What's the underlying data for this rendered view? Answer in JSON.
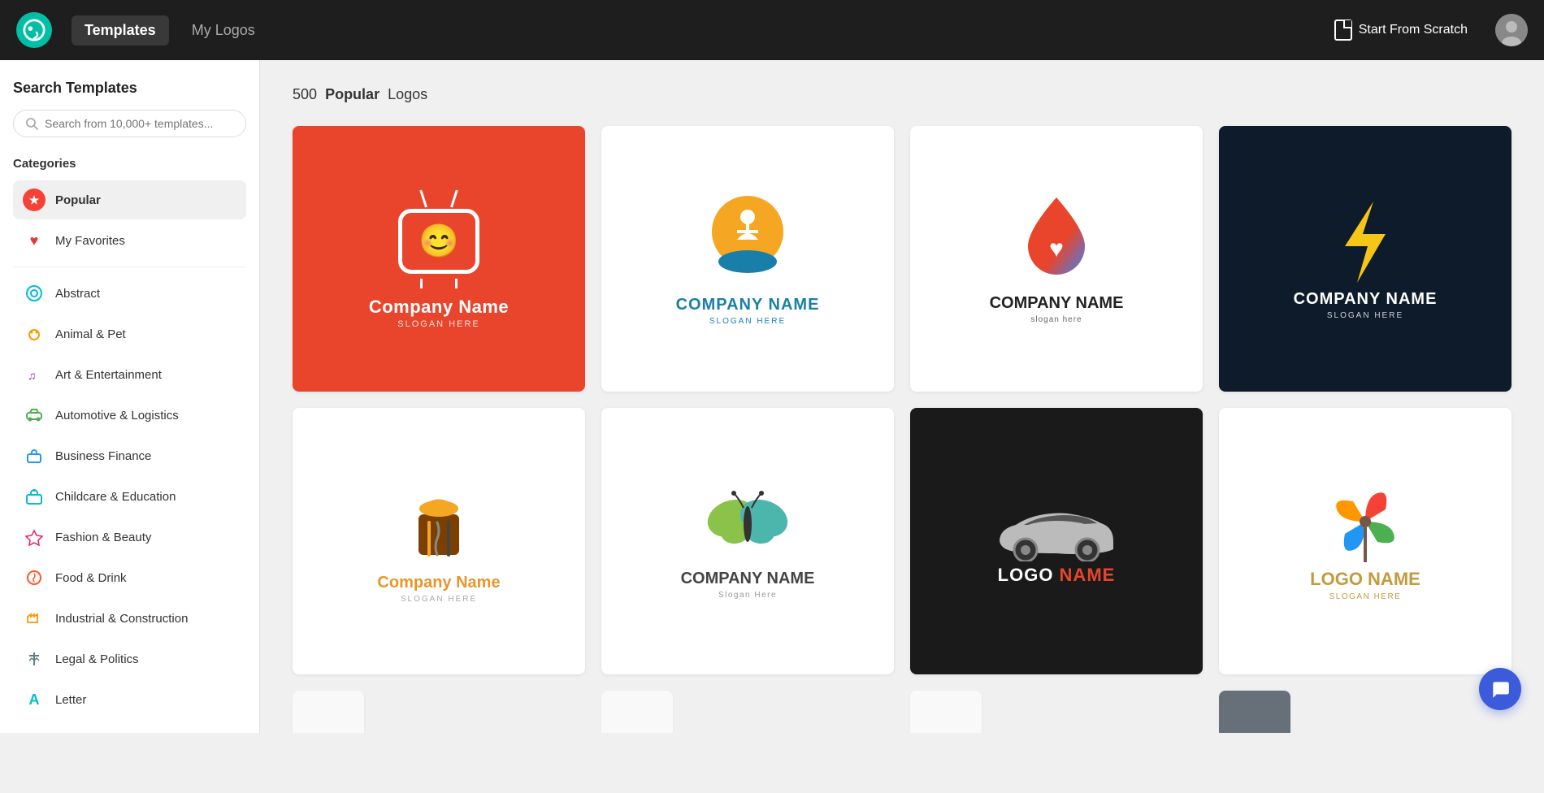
{
  "topnav": {
    "templates_label": "Templates",
    "mylogos_label": "My Logos",
    "start_scratch_label": "Start From Scratch"
  },
  "sidebar": {
    "search_title": "Search Templates",
    "search_placeholder": "Search from 10,000+ templates...",
    "categories_title": "Categories",
    "categories": [
      {
        "id": "popular",
        "label": "Popular",
        "icon": "★",
        "icon_type": "popular",
        "active": true
      },
      {
        "id": "my-favorites",
        "label": "My Favorites",
        "icon": "♥",
        "icon_type": "favorites",
        "active": false
      },
      {
        "id": "abstract",
        "label": "Abstract",
        "icon": "◎",
        "icon_type": "abstract",
        "active": false
      },
      {
        "id": "animal-pet",
        "label": "Animal & Pet",
        "icon": "⊙",
        "icon_type": "animal",
        "active": false
      },
      {
        "id": "art-entertainment",
        "label": "Art & Entertainment",
        "icon": "♫",
        "icon_type": "art",
        "active": false
      },
      {
        "id": "automotive",
        "label": "Automotive & Logistics",
        "icon": "🚗",
        "icon_type": "auto",
        "active": false
      },
      {
        "id": "business-finance",
        "label": "Business Finance",
        "icon": "💼",
        "icon_type": "business",
        "active": false
      },
      {
        "id": "childcare",
        "label": "Childcare & Education",
        "icon": "🏫",
        "icon_type": "childcare",
        "active": false
      },
      {
        "id": "fashion-beauty",
        "label": "Fashion & Beauty",
        "icon": "💎",
        "icon_type": "fashion",
        "active": false
      },
      {
        "id": "food-drink",
        "label": "Food & Drink",
        "icon": "☕",
        "icon_type": "food",
        "active": false
      },
      {
        "id": "industrial",
        "label": "Industrial & Construction",
        "icon": "⚠",
        "icon_type": "industrial",
        "active": false
      },
      {
        "id": "legal",
        "label": "Legal & Politics",
        "icon": "⚖",
        "icon_type": "legal",
        "active": false
      },
      {
        "id": "letter",
        "label": "Letter",
        "icon": "A",
        "icon_type": "letter",
        "active": false
      }
    ]
  },
  "main": {
    "results_count": "500",
    "results_keyword": "Popular",
    "results_suffix": "Logos"
  }
}
